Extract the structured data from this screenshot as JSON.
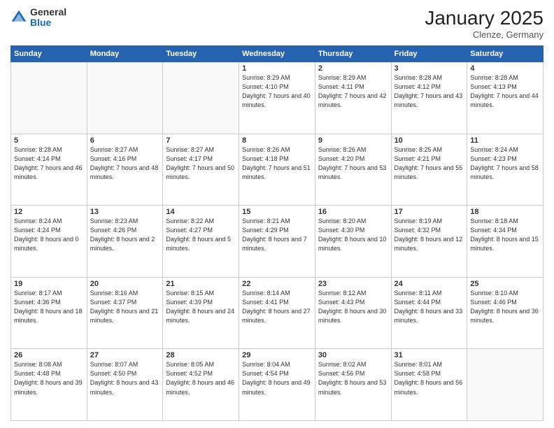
{
  "logo": {
    "general": "General",
    "blue": "Blue"
  },
  "header": {
    "month": "January 2025",
    "location": "Clenze, Germany"
  },
  "weekdays": [
    "Sunday",
    "Monday",
    "Tuesday",
    "Wednesday",
    "Thursday",
    "Friday",
    "Saturday"
  ],
  "weeks": [
    [
      {
        "day": "",
        "info": ""
      },
      {
        "day": "",
        "info": ""
      },
      {
        "day": "",
        "info": ""
      },
      {
        "day": "1",
        "info": "Sunrise: 8:29 AM\nSunset: 4:10 PM\nDaylight: 7 hours\nand 40 minutes."
      },
      {
        "day": "2",
        "info": "Sunrise: 8:29 AM\nSunset: 4:11 PM\nDaylight: 7 hours\nand 42 minutes."
      },
      {
        "day": "3",
        "info": "Sunrise: 8:28 AM\nSunset: 4:12 PM\nDaylight: 7 hours\nand 43 minutes."
      },
      {
        "day": "4",
        "info": "Sunrise: 8:28 AM\nSunset: 4:13 PM\nDaylight: 7 hours\nand 44 minutes."
      }
    ],
    [
      {
        "day": "5",
        "info": "Sunrise: 8:28 AM\nSunset: 4:14 PM\nDaylight: 7 hours\nand 46 minutes."
      },
      {
        "day": "6",
        "info": "Sunrise: 8:27 AM\nSunset: 4:16 PM\nDaylight: 7 hours\nand 48 minutes."
      },
      {
        "day": "7",
        "info": "Sunrise: 8:27 AM\nSunset: 4:17 PM\nDaylight: 7 hours\nand 50 minutes."
      },
      {
        "day": "8",
        "info": "Sunrise: 8:26 AM\nSunset: 4:18 PM\nDaylight: 7 hours\nand 51 minutes."
      },
      {
        "day": "9",
        "info": "Sunrise: 8:26 AM\nSunset: 4:20 PM\nDaylight: 7 hours\nand 53 minutes."
      },
      {
        "day": "10",
        "info": "Sunrise: 8:25 AM\nSunset: 4:21 PM\nDaylight: 7 hours\nand 55 minutes."
      },
      {
        "day": "11",
        "info": "Sunrise: 8:24 AM\nSunset: 4:23 PM\nDaylight: 7 hours\nand 58 minutes."
      }
    ],
    [
      {
        "day": "12",
        "info": "Sunrise: 8:24 AM\nSunset: 4:24 PM\nDaylight: 8 hours\nand 0 minutes."
      },
      {
        "day": "13",
        "info": "Sunrise: 8:23 AM\nSunset: 4:26 PM\nDaylight: 8 hours\nand 2 minutes."
      },
      {
        "day": "14",
        "info": "Sunrise: 8:22 AM\nSunset: 4:27 PM\nDaylight: 8 hours\nand 5 minutes."
      },
      {
        "day": "15",
        "info": "Sunrise: 8:21 AM\nSunset: 4:29 PM\nDaylight: 8 hours\nand 7 minutes."
      },
      {
        "day": "16",
        "info": "Sunrise: 8:20 AM\nSunset: 4:30 PM\nDaylight: 8 hours\nand 10 minutes."
      },
      {
        "day": "17",
        "info": "Sunrise: 8:19 AM\nSunset: 4:32 PM\nDaylight: 8 hours\nand 12 minutes."
      },
      {
        "day": "18",
        "info": "Sunrise: 8:18 AM\nSunset: 4:34 PM\nDaylight: 8 hours\nand 15 minutes."
      }
    ],
    [
      {
        "day": "19",
        "info": "Sunrise: 8:17 AM\nSunset: 4:36 PM\nDaylight: 8 hours\nand 18 minutes."
      },
      {
        "day": "20",
        "info": "Sunrise: 8:16 AM\nSunset: 4:37 PM\nDaylight: 8 hours\nand 21 minutes."
      },
      {
        "day": "21",
        "info": "Sunrise: 8:15 AM\nSunset: 4:39 PM\nDaylight: 8 hours\nand 24 minutes."
      },
      {
        "day": "22",
        "info": "Sunrise: 8:14 AM\nSunset: 4:41 PM\nDaylight: 8 hours\nand 27 minutes."
      },
      {
        "day": "23",
        "info": "Sunrise: 8:12 AM\nSunset: 4:43 PM\nDaylight: 8 hours\nand 30 minutes."
      },
      {
        "day": "24",
        "info": "Sunrise: 8:11 AM\nSunset: 4:44 PM\nDaylight: 8 hours\nand 33 minutes."
      },
      {
        "day": "25",
        "info": "Sunrise: 8:10 AM\nSunset: 4:46 PM\nDaylight: 8 hours\nand 36 minutes."
      }
    ],
    [
      {
        "day": "26",
        "info": "Sunrise: 8:08 AM\nSunset: 4:48 PM\nDaylight: 8 hours\nand 39 minutes."
      },
      {
        "day": "27",
        "info": "Sunrise: 8:07 AM\nSunset: 4:50 PM\nDaylight: 8 hours\nand 43 minutes."
      },
      {
        "day": "28",
        "info": "Sunrise: 8:05 AM\nSunset: 4:52 PM\nDaylight: 8 hours\nand 46 minutes."
      },
      {
        "day": "29",
        "info": "Sunrise: 8:04 AM\nSunset: 4:54 PM\nDaylight: 8 hours\nand 49 minutes."
      },
      {
        "day": "30",
        "info": "Sunrise: 8:02 AM\nSunset: 4:56 PM\nDaylight: 8 hours\nand 53 minutes."
      },
      {
        "day": "31",
        "info": "Sunrise: 8:01 AM\nSunset: 4:58 PM\nDaylight: 8 hours\nand 56 minutes."
      },
      {
        "day": "",
        "info": ""
      }
    ]
  ]
}
